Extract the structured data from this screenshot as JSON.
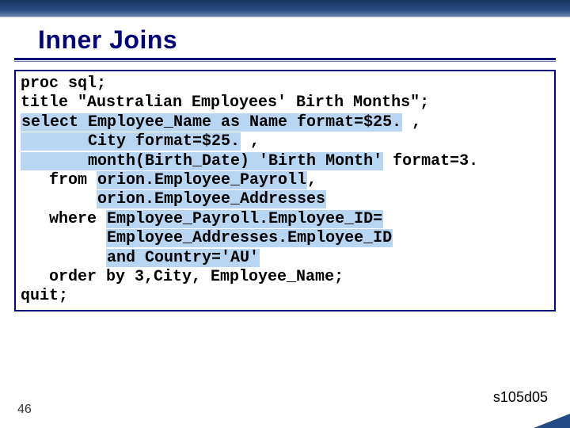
{
  "slide": {
    "title": "Inner Joins",
    "page_number": "46",
    "reference": "s105d05"
  },
  "code": {
    "l1": "proc sql;",
    "l2": "title \"Australian Employees' Birth Months\";",
    "l3a": "select Employee_Name as Name format=$25.",
    "l3b": " ,",
    "l4a": "       City format=$25.",
    "l4b": " ,",
    "l5a": "       month(Birth_Date) 'Birth Month'",
    "l5b": " format=3.",
    "l6a": "   from ",
    "l6b": "orion.Employee_Payroll",
    "l6c": ",",
    "l7a": "        ",
    "l7b": "orion.Employee_Addresses",
    "l8a": "   where ",
    "l8b": "Employee_Payroll.Employee_ID=",
    "l9a": "         ",
    "l9b": "Employee_Addresses.Employee_ID",
    "l10a": "         ",
    "l10b": "and Country='AU'",
    "l11": "   order by 3,City, Employee_Name;",
    "l12": "quit;"
  }
}
